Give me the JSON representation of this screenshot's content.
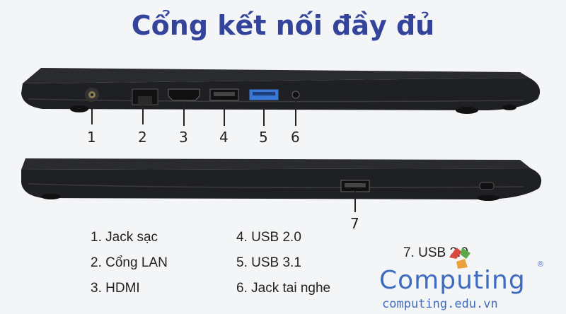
{
  "title": "Cổng kết nối đầy đủ",
  "port_numbers": [
    "1",
    "2",
    "3",
    "4",
    "5",
    "6",
    "7"
  ],
  "legend": {
    "col1": [
      "1. Jack sạc",
      "2. Cổng LAN",
      "3. HDMI"
    ],
    "col2": [
      "4. USB 2.0",
      "5. USB 3.1",
      "6. Jack tai nghe"
    ],
    "col3": [
      "7. USB 2.0"
    ]
  },
  "logo": {
    "word": "Computing",
    "registered": "®",
    "url": "computing.edu.vn"
  },
  "colors": {
    "title": "#34449b",
    "usb3_port": "#3a78d8",
    "logo_blue": "#3e6cc0",
    "logo_red": "#d94a3e",
    "logo_green": "#5aa84a",
    "logo_orange": "#e8a13b"
  },
  "icons": [
    "laptop-left-side-image",
    "laptop-right-side-image",
    "dc-power-jack-icon",
    "lan-port-icon",
    "hdmi-port-icon",
    "usb-port-icon",
    "audio-jack-icon",
    "kensington-lock-icon"
  ]
}
